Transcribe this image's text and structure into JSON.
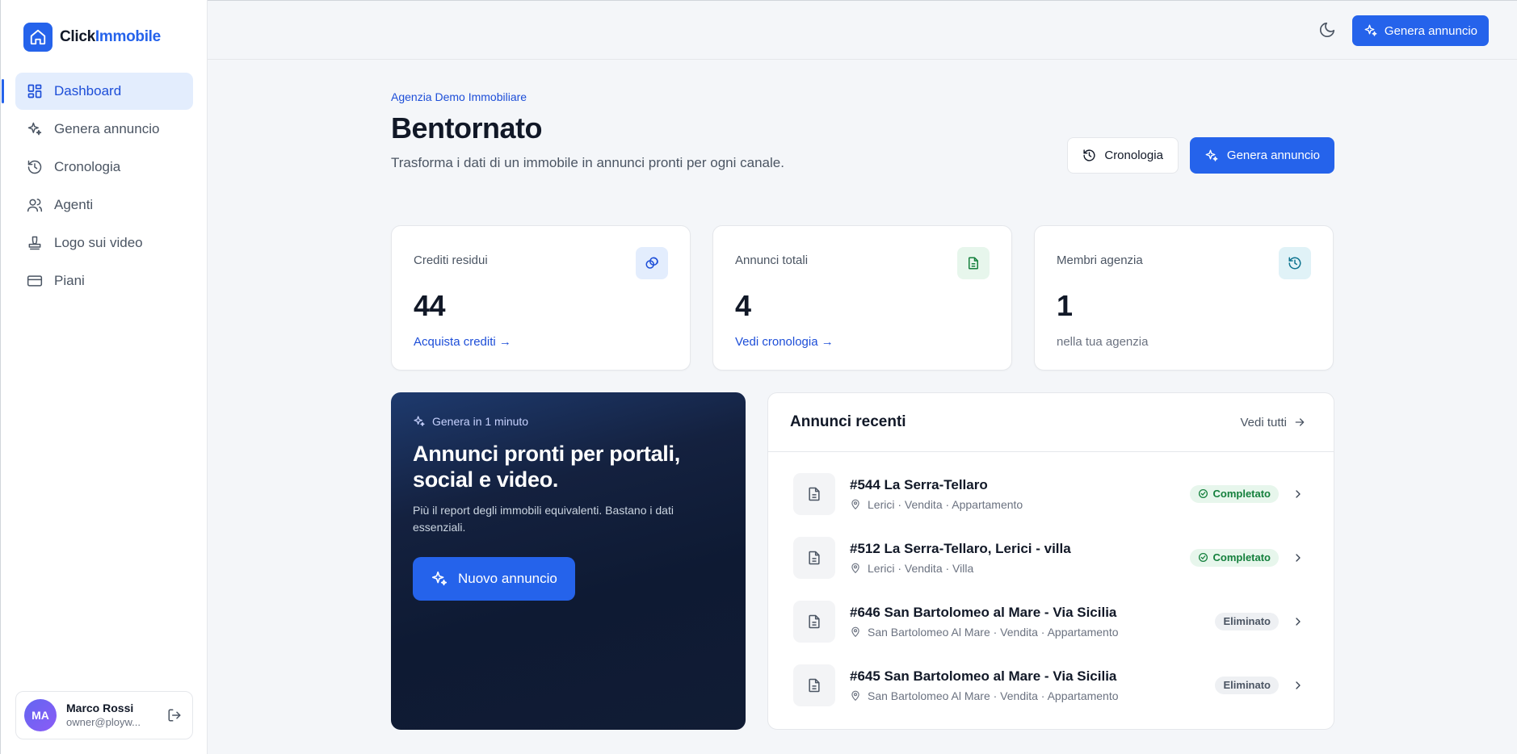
{
  "brand": {
    "name_a": "Click",
    "name_b": "Immobile"
  },
  "colors": {
    "accent": "#2563eb",
    "success": "#15803d",
    "dark": "#0e1a33"
  },
  "sidebar": {
    "items": [
      {
        "label": "Dashboard",
        "icon": "dashboard-icon",
        "active": true
      },
      {
        "label": "Genera annuncio",
        "icon": "sparkles-icon"
      },
      {
        "label": "Cronologia",
        "icon": "history-icon"
      },
      {
        "label": "Agenti",
        "icon": "users-icon"
      },
      {
        "label": "Logo sui video",
        "icon": "stamp-icon"
      },
      {
        "label": "Piani",
        "icon": "credit-card-icon"
      }
    ]
  },
  "user": {
    "initials": "MA",
    "name": "Marco Rossi",
    "email": "owner@ployw..."
  },
  "topbar": {
    "cta_label": "Genera annuncio",
    "theme_icon": "moon-icon"
  },
  "header": {
    "agency": "Agenzia Demo Immobiliare",
    "title": "Bentornato",
    "subtitle": "Trasforma i dati di un immobile in annunci pronti per ogni canale.",
    "history_button": "Cronologia",
    "generate_button": "Genera annuncio"
  },
  "stats": [
    {
      "label": "Crediti residui",
      "value": "44",
      "link": "Acquista crediti →",
      "icon": "coins-icon"
    },
    {
      "label": "Annunci totali",
      "value": "4",
      "link": "Vedi cronologia →",
      "icon": "document-icon"
    },
    {
      "label": "Membri agenzia",
      "value": "1",
      "note": "nella tua agenzia",
      "icon": "history-icon"
    }
  ],
  "promo": {
    "eyebrow": "Genera in 1 minuto",
    "title": "Annunci pronti per portali, social e video.",
    "text": "Più il report degli immobili equivalenti. Bastano i dati essenziali.",
    "button": "Nuovo annuncio"
  },
  "recent": {
    "title": "Annunci recenti",
    "see_all": "Vedi tutti",
    "rows": [
      {
        "title": "#544 La Serra-Tellaro",
        "meta": "Lerici · Vendita · Appartamento",
        "status": "Completato",
        "status_type": "ok"
      },
      {
        "title": "#512 La Serra-Tellaro, Lerici - villa",
        "meta": "Lerici · Vendita · Villa",
        "status": "Completato",
        "status_type": "ok"
      },
      {
        "title": "#646 San Bartolomeo al Mare - Via Sicilia",
        "meta": "San Bartolomeo Al Mare · Vendita · Appartamento",
        "status": "Eliminato",
        "status_type": "del"
      },
      {
        "title": "#645 San Bartolomeo al Mare - Via Sicilia",
        "meta": "San Bartolomeo Al Mare · Vendita · Appartamento",
        "status": "Eliminato",
        "status_type": "del"
      }
    ]
  }
}
